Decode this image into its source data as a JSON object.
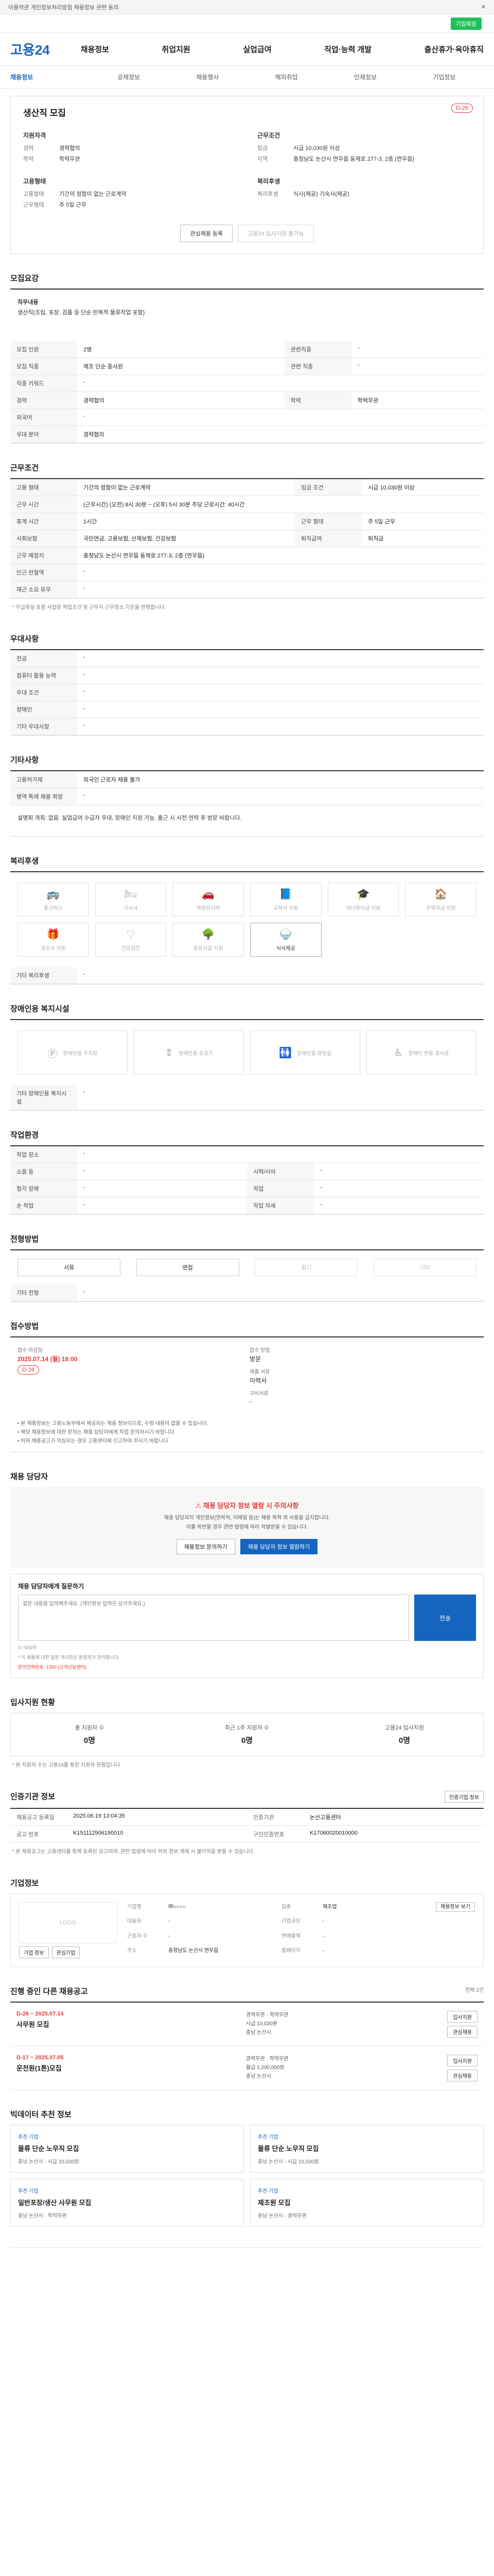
{
  "topbar": {
    "notice": "이용약관 개인정보처리방침 채용정보 관련 동의",
    "close": "닫기"
  },
  "greenbar": {
    "btn": "기업회원"
  },
  "header": {
    "logo": "고용24",
    "menu": [
      "채용정보",
      "취업지원",
      "실업급여",
      "직업·능력 개발",
      "출산휴가·육아휴직"
    ]
  },
  "lnb": [
    "채용정보",
    "공채정보",
    "채용행사",
    "해외취업",
    "인재정보",
    "기업정보"
  ],
  "job": {
    "title": "생산직 모집",
    "dday": "D-26",
    "left_title": "지원자격",
    "left_rows": [
      {
        "k": "경력",
        "v": "경력협의"
      },
      {
        "k": "학력",
        "v": "학력무관"
      }
    ],
    "right_title": "근무조건",
    "right_rows": [
      {
        "k": "임금",
        "v": "시급 10,030원 이상"
      },
      {
        "k": "지역",
        "v": "충청남도 논산시 연무읍 동제로 277-3, 2층 (연무읍)"
      }
    ],
    "left2_title": "고용형태",
    "left2_rows": [
      {
        "k": "고용형태",
        "v": "기간의 정함이 없는 근로계약"
      },
      {
        "k": "근무형태",
        "v": "주 5일 근무"
      }
    ],
    "right2_title": "복리후생",
    "right2_rows": [
      {
        "k": "복리후생",
        "v": "식사(제공) 기숙사(제공)"
      }
    ],
    "btn_scrap": "관심채용 등록",
    "btn_apply": "고용24 입사지원 불가능"
  },
  "sec": {
    "detail": "모집요강",
    "work": "근무조건",
    "prefer": "우대사항",
    "etc": "기타사항",
    "welfare": "복리후생",
    "disabled": "장애인용 복지시설",
    "env": "작업환경",
    "process": "전형방법",
    "apply": "접수방법",
    "qna": "채용 담당자",
    "stat": "입사지원 현황",
    "cmp": "인증기관 정보",
    "company": "기업정보",
    "related": "진행 중인 다른 채용공고",
    "rec": "빅데이터 추천 정보"
  },
  "detail": {
    "desc_title": "직무내용",
    "desc": "생산직(조립, 포장, 검품 등 단순 반복적 물류작업 포함)",
    "rows": [
      {
        "k": "모집 인원",
        "v": "2명",
        "k2": "관련직종",
        "v2": "-"
      },
      {
        "k": "모집 직종",
        "v": "제조 단순 종사원",
        "k2": "관련 직종",
        "v2": "-"
      },
      {
        "k": "직종 키워드",
        "v": "-",
        "k2": "",
        "v2": ""
      },
      {
        "k": "경력",
        "v": "경력협의",
        "k2": "학력",
        "v2": "학력무관"
      },
      {
        "k": "외국어",
        "v": "-",
        "k2": "",
        "v2": ""
      },
      {
        "k": "우대 분야",
        "v": "경력협의",
        "k2": "",
        "v2": ""
      }
    ]
  },
  "work": {
    "rows": [
      {
        "k": "고용 형태",
        "v": "기간의 정함이 없는 근로계약",
        "k2": "임금 조건",
        "v2": "시급 10,030원 이상"
      },
      {
        "k": "근무 시간",
        "v": "(근무시간) (오전) 8시 30분 ~ (오후) 5시 30분 주당 근로시간: 40시간",
        "k2": "",
        "v2": ""
      },
      {
        "k": "휴게 시간",
        "v": "1시간",
        "k2": "근무 형태",
        "v2": "주 5일 근무"
      },
      {
        "k": "사회보험",
        "v": "국민연금, 고용보험, 산재보험, 건강보험",
        "k2": "퇴직급여",
        "v2": "퇴직금"
      },
      {
        "k": "근무 예정지",
        "v": "충청남도 논산시 연무읍 동제로 277-3, 2층 (연무읍)",
        "k2": "",
        "v2": ""
      },
      {
        "k": "인근 전철역",
        "v": "-",
        "k2": "",
        "v2": ""
      },
      {
        "k": "재근 소요 유무",
        "v": "-",
        "k2": "",
        "v2": ""
      }
    ],
    "note": "* 무급휴일 포함 사업장 작업조건 및 근무지 근무장소 기준을 반영합니다."
  },
  "prefer": [
    {
      "k": "전공",
      "v": "-"
    },
    {
      "k": "컴퓨터 활용 능력",
      "v": "-"
    },
    {
      "k": "우대 조건",
      "v": "-"
    },
    {
      "k": "장애인",
      "v": "-"
    },
    {
      "k": "기타 우대사항",
      "v": "-"
    }
  ],
  "etc": [
    {
      "k": "고용허가제",
      "v": "외국인 근로자 채용 불가"
    },
    {
      "k": "병역 특례 채용 희망",
      "v": "-"
    }
  ],
  "etc_desc": "설명회 개최: 없음. 실업급여 수급자 우대, 장애인 지원 가능. 출근 시 사전 연락 후 방문 바랍니다.",
  "welfare": [
    {
      "name": "통근버스",
      "on": false,
      "icon": "bus-icon"
    },
    {
      "name": "기숙사",
      "on": false,
      "icon": "bed-icon"
    },
    {
      "name": "차량유지비",
      "on": false,
      "icon": "car-icon"
    },
    {
      "name": "교육비 지원",
      "on": false,
      "icon": "book-icon"
    },
    {
      "name": "자녀학자금 지원",
      "on": false,
      "icon": "graduation-icon"
    },
    {
      "name": "주택자금 지원",
      "on": false,
      "icon": "house-icon"
    },
    {
      "name": "경조사 지원",
      "on": false,
      "icon": "gift-icon"
    },
    {
      "name": "건강검진",
      "on": false,
      "icon": "heart-icon"
    },
    {
      "name": "휴양시설 지원",
      "on": false,
      "icon": "tree-icon"
    },
    {
      "name": "식사제공",
      "on": true,
      "icon": "meal-icon"
    }
  ],
  "welfare_extra": {
    "k": "기타 복리후생",
    "v": "-"
  },
  "disabled": [
    {
      "name": "장애인용 주차장",
      "icon": "parking-icon"
    },
    {
      "name": "장애인용 승강기",
      "icon": "elevator-icon"
    },
    {
      "name": "장애인용 화장실",
      "icon": "toilet-icon"
    },
    {
      "name": "장애인 전용 경사로",
      "icon": "ramp-icon"
    }
  ],
  "disabled_extra": {
    "k": "기타 장애인용 복지시설",
    "v": "-"
  },
  "env": [
    {
      "k": "작업 장소",
      "v": "-",
      "k2": "",
      "v2": ""
    },
    {
      "k": "소음 등",
      "v": "-",
      "k2": "시력/시야",
      "v2": "-"
    },
    {
      "k": "청각 장애",
      "v": "-",
      "k2": "작업",
      "v2": "-"
    },
    {
      "k": "손 작업",
      "v": "-",
      "k2": "작업 자세",
      "v2": "-"
    }
  ],
  "process": [
    "서류",
    "면접",
    "필기",
    "기타"
  ],
  "process_on": [
    true,
    true,
    false,
    false
  ],
  "process_extra": {
    "k": "기타 전형",
    "v": "-"
  },
  "apply": {
    "label1": "접수 마감일",
    "val1": "2025.07.14 (월) 18:00",
    "dday": "D-26",
    "label2": "접수 방법",
    "val2": "방문",
    "label3": "제출 서류",
    "val3": "이력서",
    "label4": "구비서류",
    "val4": "-"
  },
  "apply_bullets": [
    "본 채용정보는 고용노동부에서 제공되는 채용 정보이므로, 수정 내용이 없을 수 있습니다.",
    "해당 채용정보에 대한 문의는 채용 담당자에게 직접 문의하시기 바랍니다.",
    "허위 채용공고가 의심되는 경우 고용센터에 신고하여 주시기 바랍니다."
  ],
  "qna": {
    "title": "채용 담당자에게 직접 문의",
    "title_red": "채용 담당자 정보 열람 시 주의사항",
    "p1": "채용 담당자의 개인정보(연락처, 이메일 등)는 채용 목적 외 사용을 금지합니다.",
    "p2": "이를 위반할 경우 관련 법령에 따라 처벌받을 수 있습니다.",
    "btn1": "채용정보 문의하기",
    "btn2": "채용 담당자 정보 열람하기",
    "input_title": "채용 담당자에게 질문하기",
    "placeholder": "질문 내용을 입력해주세요. (개인정보 입력은 삼가주세요.)",
    "send": "전송",
    "count": "0 / 500자",
    "note1": "* 이 채용에 대한 질문 게시판은 운영자가 관리합니다.",
    "note2": "문의전화번호: 1350 (고객상담센터)"
  },
  "stat": {
    "items": [
      {
        "k": "총 지원자 수",
        "v": "0명"
      },
      {
        "k": "최근 1주 지원자 수",
        "v": "0명"
      },
      {
        "k": "고용24 입사지원",
        "v": "0명"
      }
    ],
    "note": "* 본 지원자 수는 고용24를 통한 지원자 현황입니다."
  },
  "cmp": {
    "btn": "인증기업 정보",
    "rows": [
      {
        "k": "채용공고 등록일",
        "v": "2025.06.19 13:04:35",
        "k2": "인증기관",
        "v2": "논산고용센터"
      },
      {
        "k": "공고 번호",
        "v": "K151112506190010",
        "k2": "구인인증번호",
        "v2": "K17060020010000"
      }
    ],
    "note": "* 본 채용공고는 고용센터를 통해 등록된 공고이며, 관련 법령에 따라 허위 정보 게재 시 불이익을 받을 수 있습니다."
  },
  "company": {
    "logo_alt": "LOGO",
    "btn1": "기업 정보",
    "btn2": "관심기업",
    "rows": [
      {
        "k": "기업명",
        "v": "㈜○○○○"
      },
      {
        "k": "업종",
        "v": "제조업"
      },
      {
        "k": "대표자",
        "v": "-"
      },
      {
        "k": "기업규모",
        "v": "-"
      },
      {
        "k": "근로자 수",
        "v": "-"
      },
      {
        "k": "연매출액",
        "v": "-"
      },
      {
        "k": "주소",
        "v": "충청남도 논산시 연무읍"
      },
      {
        "k": "홈페이지",
        "v": "-"
      }
    ],
    "btn3": "채용정보 보기"
  },
  "related": {
    "count": "전체 2건",
    "items": [
      {
        "dday": "D-26 ~ 2025.07.14",
        "name": "사무원 모집",
        "m1": "경력무관 · 학력무관",
        "m2": "시급 10,030원",
        "m3": "충남 논산시",
        "btn1": "입사지원",
        "btn2": "관심채용"
      },
      {
        "dday": "D-17 ~ 2025.07.05",
        "name": "운전원(1톤)모집",
        "m1": "경력무관 · 학력무관",
        "m2": "월급 2,200,000원",
        "m3": "충남 논산시",
        "btn1": "입사지원",
        "btn2": "관심채용"
      }
    ]
  },
  "rec": [
    {
      "c": "추천 기업",
      "t": "물류 단순 노무직 모집",
      "m": "충남 논산시 · 시급 10,030원"
    },
    {
      "c": "추천 기업",
      "t": "물류 단순 노무직 모집",
      "m": "충남 논산시 · 시급 10,030원"
    },
    {
      "c": "추천 기업",
      "t": "일반포장/생산 사무원 모집",
      "m": "충남 논산시 · 학력무관"
    },
    {
      "c": "추천 기업",
      "t": "제조원 모집",
      "m": "충남 논산시 · 경력무관"
    }
  ]
}
